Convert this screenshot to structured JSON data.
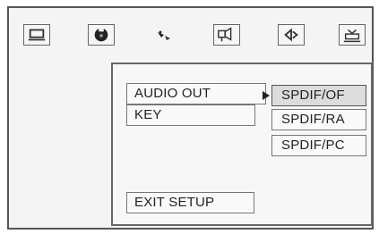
{
  "tabs": [
    {
      "icon": "tv-screen-icon"
    },
    {
      "icon": "disc-icon"
    },
    {
      "icon": "satellite-icon"
    },
    {
      "icon": "speaker-settings-icon"
    },
    {
      "icon": "audio-speaker-icon"
    },
    {
      "icon": "preferences-icon"
    }
  ],
  "menu": {
    "items": [
      "AUDIO OUT",
      "KEY"
    ],
    "exit_label": "EXIT SETUP"
  },
  "submenu": {
    "selected_index": 0,
    "options": [
      "SPDIF/OF",
      "SPDIF/RA",
      "SPDIF/PC"
    ]
  }
}
